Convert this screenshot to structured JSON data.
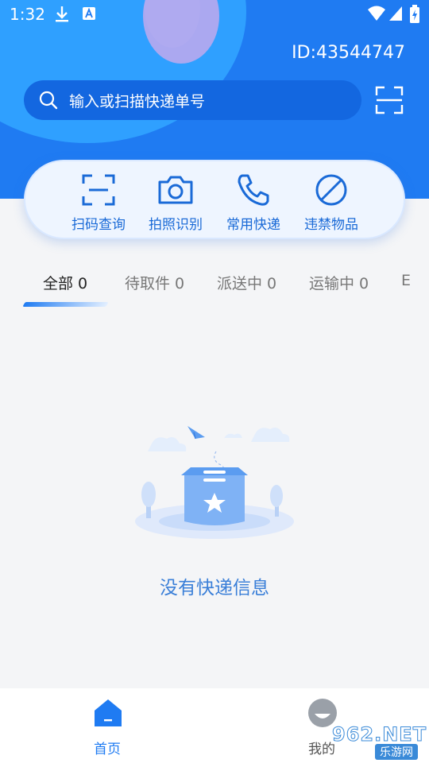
{
  "status_bar": {
    "time": "1:32"
  },
  "header": {
    "user_id": "ID:43544747"
  },
  "search": {
    "placeholder": "输入或扫描快递单号"
  },
  "quick_actions": [
    {
      "label": "扫码查询",
      "icon": "scan-frame-icon"
    },
    {
      "label": "拍照识别",
      "icon": "camera-icon"
    },
    {
      "label": "常用快递",
      "icon": "phone-icon"
    },
    {
      "label": "违禁物品",
      "icon": "prohibited-icon"
    }
  ],
  "tabs": [
    {
      "label": "全部 0",
      "active": true
    },
    {
      "label": "待取件 0",
      "active": false
    },
    {
      "label": "派送中 0",
      "active": false
    },
    {
      "label": "运输中 0",
      "active": false
    },
    {
      "label": "E",
      "active": false
    }
  ],
  "empty_state": {
    "message": "没有快递信息"
  },
  "bottom_nav": [
    {
      "label": "首页",
      "icon": "home-icon",
      "active": true
    },
    {
      "label": "我的",
      "icon": "profile-icon",
      "active": false
    }
  ],
  "watermark": {
    "text": "962.NET",
    "sub": "乐游网"
  },
  "colors": {
    "primary": "#1f7bf2",
    "search_bg": "#1367e0",
    "accent_text": "#1a6ad7"
  }
}
